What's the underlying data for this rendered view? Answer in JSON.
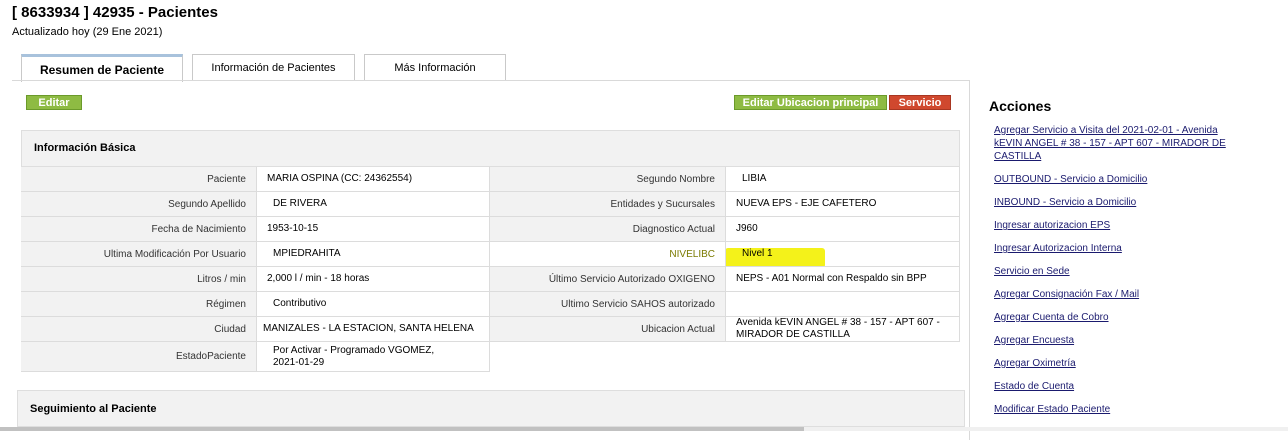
{
  "header": {
    "title": "[ 8633934 ] 42935 - Pacientes",
    "updated": "Actualizado hoy (29 Ene 2021)"
  },
  "tabs": [
    {
      "label": "Resumen de Paciente",
      "active": true
    },
    {
      "label": "Información de Pacientes",
      "active": false
    },
    {
      "label": "Más Información",
      "active": false
    }
  ],
  "toolbar": {
    "edit_label": "Editar",
    "edit_location_label": "Editar Ubicacion principal",
    "service_label": "Servicio"
  },
  "info_basica": {
    "title": "Información Básica",
    "rows": [
      {
        "l1": "Paciente",
        "v1": "MARIA OSPINA (CC: 24362554)",
        "l2": "Segundo Nombre",
        "v2": "LIBIA"
      },
      {
        "l1": "Segundo Apellido",
        "v1": "DE RIVERA",
        "l2": "Entidades y Sucursales",
        "v2": "NUEVA EPS - EJE CAFETERO"
      },
      {
        "l1": "Fecha de Nacimiento",
        "v1": "1953-10-15",
        "l2": "Diagnostico Actual",
        "v2": "J960"
      },
      {
        "l1": "Ultima Modificación Por Usuario",
        "v1": "MPIEDRAHITA",
        "l2": "NIVELIBC",
        "v2": "Nivel 1"
      },
      {
        "l1": "Litros / min",
        "v1": "2,000 l / min - 18 horas",
        "l2": "Último Servicio Autorizado OXIGENO",
        "v2": "NEPS - A01 Normal con Respaldo sin BPP"
      },
      {
        "l1": "Régimen",
        "v1": "Contributivo",
        "l2": "Ultimo Servicio SAHOS autorizado",
        "v2": ""
      },
      {
        "l1": "Ciudad",
        "v1": "MANIZALES - LA ESTACION, SANTA HELENA",
        "l2": "Ubicacion Actual",
        "v2": "Avenida kEVIN ANGEL # 38 - 157 - APT 607 - MIRADOR DE CASTILLA"
      },
      {
        "l1": "EstadoPaciente",
        "v1": "Por Activar - Programado VGOMEZ, 2021-01-29"
      }
    ]
  },
  "seguimiento": {
    "title": "Seguimiento al Paciente"
  },
  "acciones": {
    "title": "Acciones",
    "items": [
      "Agregar Servicio a Visita del 2021-02-01 - Avenida kEVIN ANGEL # 38 - 157 - APT 607 - MIRADOR DE CASTILLA",
      "OUTBOUND - Servicio a Domicilio",
      "INBOUND - Servicio a Domicilio",
      "Ingresar autorizacion EPS",
      "Ingresar Autorizacion Interna",
      "Servicio en Sede",
      "Agregar Consignación Fax / Mail",
      "Agregar Cuenta de Cobro",
      "Agregar Encuesta",
      "Agregar Oximetría",
      "Estado de Cuenta",
      "Modificar Estado Paciente"
    ]
  },
  "colors": {
    "button_green": "#8ebb43",
    "button_red": "#d0482e",
    "highlight": "#f4f21a",
    "link": "#1a1a6e"
  }
}
